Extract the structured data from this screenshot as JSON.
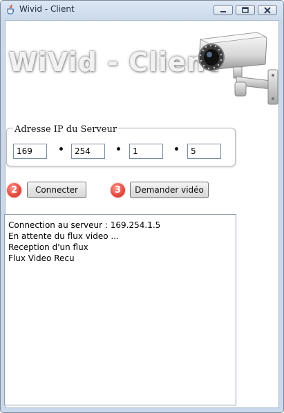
{
  "window": {
    "title": "Wivid - Client"
  },
  "banner": {
    "text": "WiVid - Client"
  },
  "ip_group": {
    "legend": "Adresse IP du Serveur",
    "octets": [
      "169",
      "254",
      "1",
      "5"
    ],
    "separator": "•"
  },
  "steps": {
    "connect_number": "2",
    "video_number": "3"
  },
  "buttons": {
    "connect": "Connecter",
    "request_video": "Demander vidéo"
  },
  "log": {
    "lines": [
      "Connection au serveur : 169.254.1.5",
      "En attente du flux video ...",
      "Reception d'un flux",
      "Flux Video Recu"
    ]
  },
  "colors": {
    "step_badge": "#e0483e",
    "titlebar": "#c9d8ea"
  },
  "icons": {
    "app": "java-cup-icon",
    "minimize": "minimize-icon",
    "maximize": "maximize-icon",
    "close": "close-icon",
    "camera": "security-camera-icon"
  }
}
